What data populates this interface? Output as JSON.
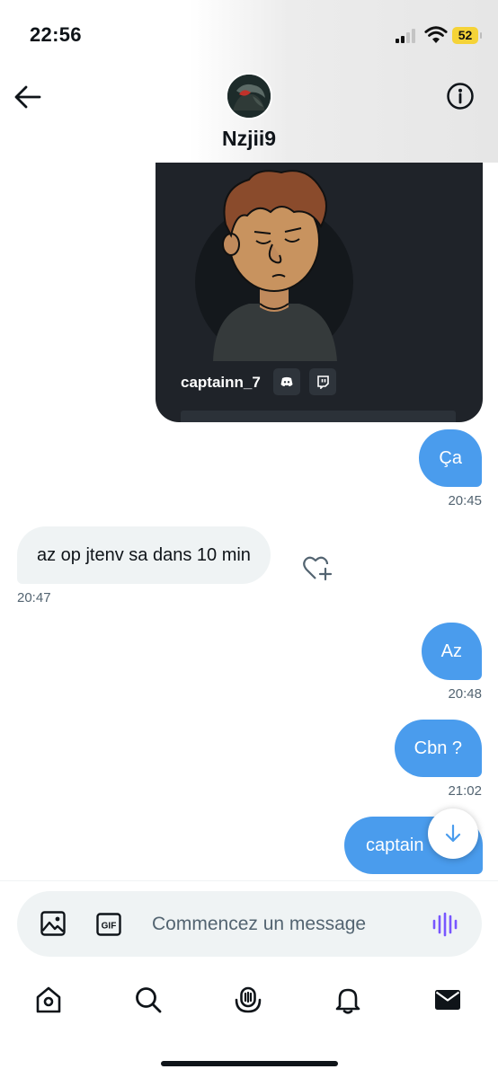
{
  "status_bar": {
    "time": "22:56",
    "battery": "52"
  },
  "header": {
    "contact_name": "Nzjii9"
  },
  "shared_card": {
    "username": "captainn_7"
  },
  "messages": [
    {
      "direction": "out",
      "text": "Ça",
      "time": "20:45"
    },
    {
      "direction": "in",
      "text": "az op jtenv sa dans 10 min",
      "time": "20:47"
    },
    {
      "direction": "out",
      "text": "Az",
      "time": "20:48"
    },
    {
      "direction": "out",
      "text": "Cbn ?",
      "time": "21:02"
    },
    {
      "direction": "out",
      "text": "captain",
      "time": ""
    }
  ],
  "composer": {
    "placeholder": "Commencez un message",
    "gif_label": "GIF"
  },
  "tab_bar": {
    "items": [
      "home-icon",
      "search-icon",
      "spaces-icon",
      "notifications-icon",
      "messages-icon"
    ]
  },
  "colors": {
    "accent": "#4a9ced",
    "incoming_bubble": "#eff3f4",
    "voice_icon": "#7856ff",
    "card_bg": "#1f2329"
  }
}
